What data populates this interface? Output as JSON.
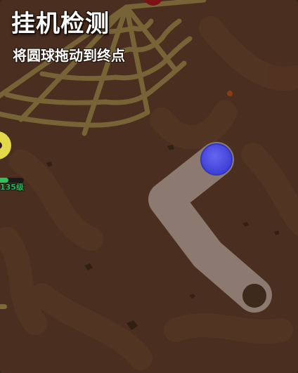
{
  "screen": {
    "title": "挂机检测",
    "subtitle": "将圆球拖动到终点"
  },
  "player_badge": {
    "level_text": "135级",
    "hp_fraction": 0.45
  },
  "palette": {
    "ground": "#4a2e1f",
    "cobweb": "#7b6a3a",
    "track": "#8c7a70",
    "drag_ball": "#5254e8",
    "goal_ring": "#3d2a1d"
  },
  "icons": {
    "drag_ball": "blue-ball-icon",
    "goal": "goal-ring-icon",
    "web": "spider-web-icon"
  }
}
